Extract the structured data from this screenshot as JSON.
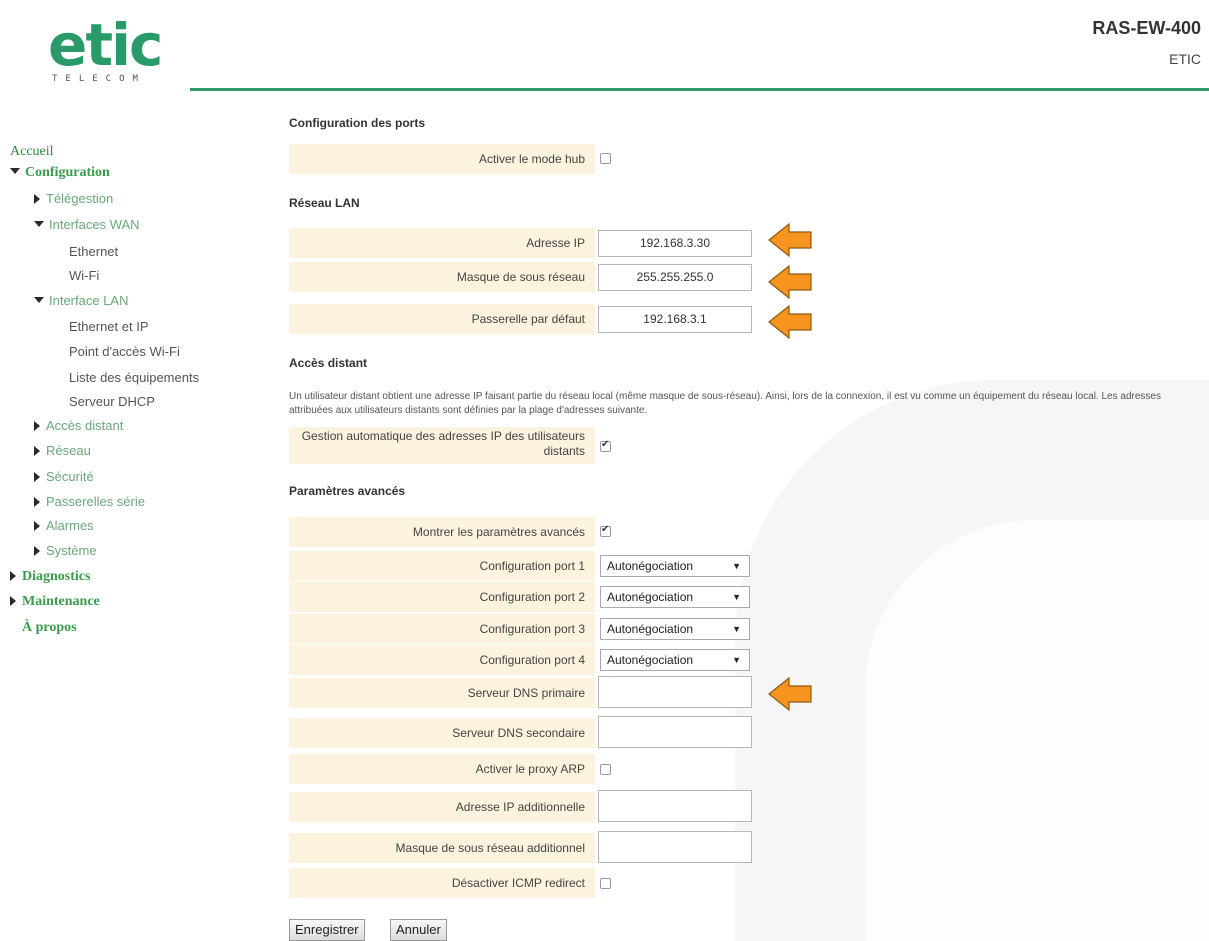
{
  "header": {
    "logo_text": "etic",
    "logo_sub": "TELECOM",
    "product_title": "RAS-EW-400",
    "product_sub": "ETIC"
  },
  "sidebar": {
    "accueil": "Accueil",
    "configuration": "Configuration",
    "telegestion": "Télégestion",
    "interfaces_wan": "Interfaces WAN",
    "ethernet": "Ethernet",
    "wifi": "Wi-Fi",
    "interface_lan": "Interface LAN",
    "ethernet_ip": "Ethernet et IP",
    "point_acces": "Point d'accès Wi-Fi",
    "liste_equip": "Liste des équipements",
    "serveur_dhcp": "Serveur DHCP",
    "acces_distant": "Accès distant",
    "reseau": "Réseau",
    "securite": "Sécurité",
    "passerelles": "Passerelles série",
    "alarmes": "Alarmes",
    "systeme": "Système",
    "diagnostics": "Diagnostics",
    "maintenance": "Maintenance",
    "apropos": "À propos"
  },
  "form": {
    "config_ports_title": "Configuration des ports",
    "hub_label": "Activer le mode hub",
    "hub_checked": false,
    "lan_title": "Réseau LAN",
    "ip_label": "Adresse IP",
    "ip_value": "192.168.3.30",
    "mask_label": "Masque de sous réseau",
    "mask_value": "255.255.255.0",
    "gw_label": "Passerelle par défaut",
    "gw_value": "192.168.3.1",
    "remote_title": "Accès distant",
    "remote_desc": "Un utilisateur distant obtient une adresse IP faisant partie du réseau local (même masque de sous-réseau). Ainsi, lors de la connexion, il est vu comme un équipement du réseau local. Les adresses attribuées aux utilisateurs distants sont définies par la plage d'adresses suivante.",
    "auto_label": "Gestion automatique des adresses IP des utilisateurs distants",
    "auto_checked": true,
    "adv_title": "Paramètres avancés",
    "show_adv_label": "Montrer les paramètres avancés",
    "show_adv_checked": true,
    "port1_label": "Configuration port 1",
    "port2_label": "Configuration port 2",
    "port3_label": "Configuration port 3",
    "port4_label": "Configuration port 4",
    "port_value": "Autonégociation",
    "dns1_label": "Serveur DNS primaire",
    "dns1_value": "",
    "dns2_label": "Serveur DNS secondaire",
    "dns2_value": "",
    "proxy_label": "Activer le proxy ARP",
    "proxy_checked": false,
    "add_ip_label": "Adresse IP additionnelle",
    "add_ip_value": "",
    "add_mask_label": "Masque de sous réseau additionnel",
    "add_mask_value": "",
    "icmp_label": "Désactiver ICMP redirect",
    "icmp_checked": false
  },
  "buttons": {
    "save": "Enregistrer",
    "cancel": "Annuler"
  },
  "colors": {
    "brand_green": "#2a9a6a",
    "row_bg": "#fcf3df",
    "callout_arrow": "#f7941d"
  },
  "icons": {
    "callout": "callout-arrow-icon"
  }
}
